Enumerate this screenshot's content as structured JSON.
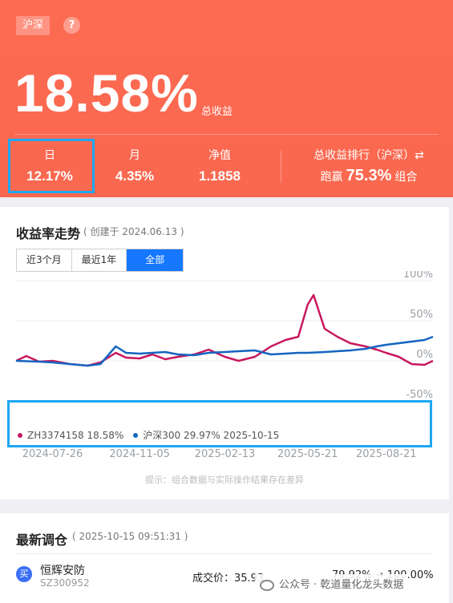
{
  "hero": {
    "market_tag": "沪深",
    "total_return": "18.58%",
    "total_return_label": "总收益",
    "stats": [
      {
        "label": "日",
        "value": "12.17%"
      },
      {
        "label": "月",
        "value": "4.35%"
      },
      {
        "label": "净值",
        "value": "1.1858"
      }
    ],
    "rank_label": "总收益排行（沪深）⇄",
    "rank_prefix": "跑赢",
    "rank_value": "75.3%",
    "rank_suffix": "组合"
  },
  "chart_card": {
    "title": "收益率走势",
    "subtitle": "( 创建于 2024.06.13 )",
    "range_tabs": [
      "近3个月",
      "最近1年",
      "全部"
    ],
    "active_tab": "全部",
    "note": "提示：组合数据与实际操作结果存在差异",
    "legend": {
      "series_a": "ZH3374158 18.58%",
      "series_b": "沪深300 29.97% 2025-10-15"
    }
  },
  "chart_data": {
    "type": "line",
    "x_ticks": [
      "2024-07-26",
      "2024-11-05",
      "2025-02-13",
      "2025-05-21",
      "2025-08-21"
    ],
    "y_ticks": [
      "100%",
      "50%",
      "0%",
      "-50%"
    ],
    "ylim": [
      -50,
      100
    ],
    "colors": {
      "portfolio": "#c8185f",
      "index": "#1565c0"
    },
    "series": [
      {
        "name": "ZH3374158",
        "x": [
          "2024-06-13",
          "2024-06-25",
          "2024-07-10",
          "2024-07-26",
          "2024-08-15",
          "2024-09-05",
          "2024-09-20",
          "2024-10-08",
          "2024-10-20",
          "2024-11-05",
          "2024-11-20",
          "2024-12-05",
          "2024-12-20",
          "2025-01-08",
          "2025-01-25",
          "2025-02-13",
          "2025-03-01",
          "2025-03-20",
          "2025-04-08",
          "2025-04-25",
          "2025-05-10",
          "2025-05-21",
          "2025-05-28",
          "2025-06-10",
          "2025-06-25",
          "2025-07-10",
          "2025-07-28",
          "2025-08-10",
          "2025-08-21",
          "2025-09-05",
          "2025-09-20",
          "2025-10-05",
          "2025-10-15"
        ],
        "y": [
          0,
          6,
          -1,
          0,
          -4,
          -6,
          -2,
          10,
          4,
          3,
          8,
          2,
          5,
          8,
          14,
          5,
          0,
          5,
          18,
          26,
          30,
          70,
          82,
          40,
          30,
          22,
          18,
          14,
          10,
          5,
          -4,
          -5,
          0
        ]
      },
      {
        "name": "沪深300",
        "x": [
          "2024-06-13",
          "2024-07-10",
          "2024-07-26",
          "2024-08-15",
          "2024-09-05",
          "2024-09-20",
          "2024-10-08",
          "2024-10-20",
          "2024-11-05",
          "2024-11-20",
          "2024-12-05",
          "2024-12-20",
          "2025-01-08",
          "2025-01-25",
          "2025-02-13",
          "2025-03-01",
          "2025-03-20",
          "2025-04-08",
          "2025-04-25",
          "2025-05-10",
          "2025-05-21",
          "2025-06-10",
          "2025-06-25",
          "2025-07-10",
          "2025-07-28",
          "2025-08-10",
          "2025-08-21",
          "2025-09-05",
          "2025-09-20",
          "2025-10-05",
          "2025-10-15"
        ],
        "y": [
          0,
          -1,
          -2,
          -4,
          -6,
          -4,
          18,
          10,
          9,
          10,
          11,
          8,
          7,
          10,
          11,
          12,
          13,
          8,
          9,
          10,
          10,
          11,
          12,
          13,
          15,
          18,
          20,
          22,
          24,
          26,
          29.97
        ]
      }
    ]
  },
  "trade_card": {
    "title": "最新调仓",
    "date": "( 2025-10-15 09:51:31 )",
    "action_icon": "买",
    "stock_name": "恒辉安防",
    "stock_code": "SZ300952",
    "price_label": "成交价：35.93",
    "weight_change": "79.92% → 100.00%"
  },
  "watermark": "公众号 · 乾道量化龙头数据"
}
